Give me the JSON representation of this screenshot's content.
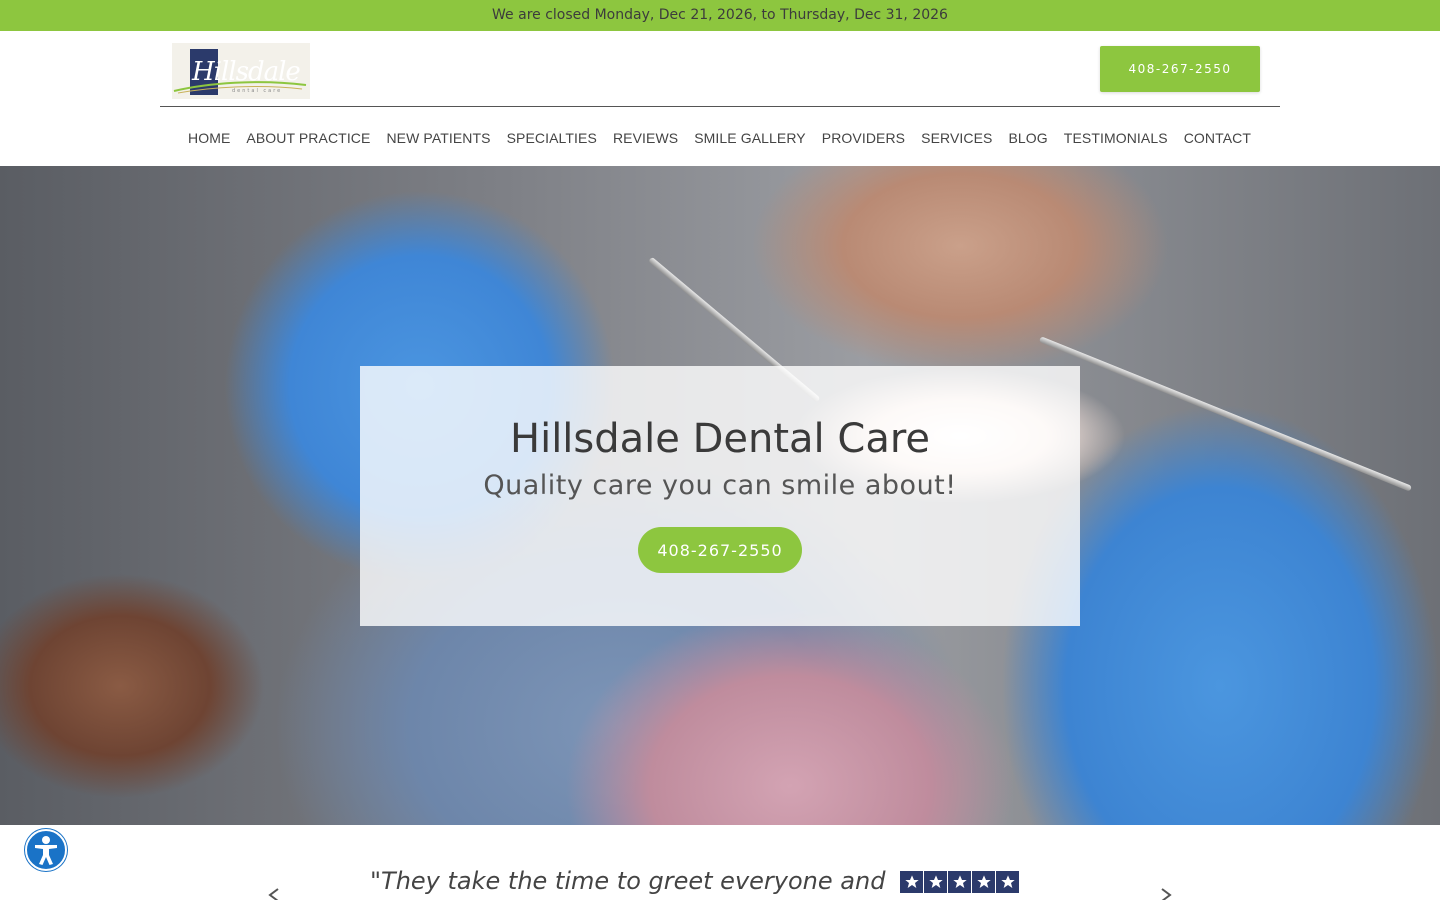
{
  "announcement": "We are closed Monday, Dec 21, 2026, to Thursday, Dec 31, 2026",
  "logo": {
    "text": "Hillsdale",
    "subtext": "dental care"
  },
  "header": {
    "phone_label": "408-267-2550"
  },
  "nav": {
    "items": [
      {
        "label": "HOME"
      },
      {
        "label": "ABOUT PRACTICE"
      },
      {
        "label": "NEW PATIENTS"
      },
      {
        "label": "SPECIALTIES"
      },
      {
        "label": "REVIEWS"
      },
      {
        "label": "SMILE GALLERY"
      },
      {
        "label": "PROVIDERS"
      },
      {
        "label": "SERVICES"
      },
      {
        "label": "BLOG"
      },
      {
        "label": "TESTIMONIALS"
      },
      {
        "label": "CONTACT"
      }
    ]
  },
  "hero": {
    "title": "Hillsdale Dental Care",
    "subtitle": "Quality care you can smile about!",
    "button_label": "408-267-2550"
  },
  "testimonial": {
    "quote": "\"They take the time to greet everyone and",
    "rating": 5
  },
  "colors": {
    "accent": "#8dc63f",
    "brand_navy": "#2b3a6b",
    "accessibility_blue": "#1a73c7"
  },
  "icons": {
    "accessibility": "accessibility-icon",
    "star": "star-icon",
    "prev": "chevron-left-icon",
    "next": "chevron-right-icon"
  }
}
